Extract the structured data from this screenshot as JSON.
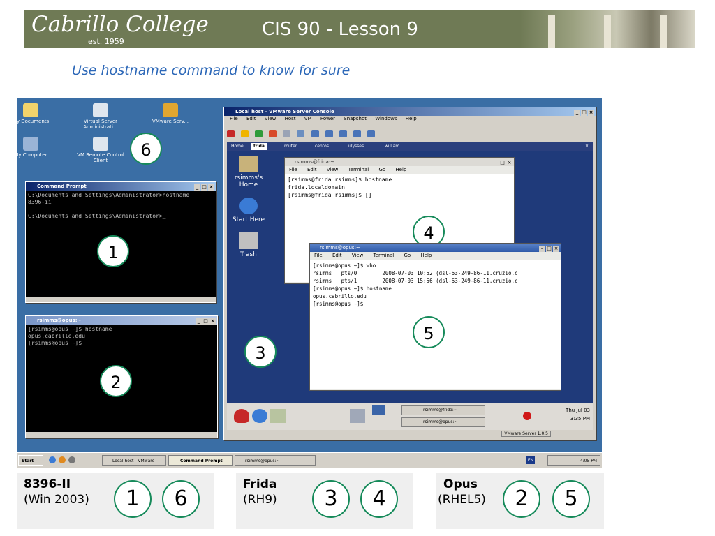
{
  "header": {
    "logo_text": "Cabrillo College",
    "logo_est": "est. 1959",
    "title": "CIS 90 - Lesson 9"
  },
  "subtitle": "Use hostname command to know for sure",
  "desktop": {
    "icons": [
      {
        "label": "My Documents",
        "icon": "folder-documents-icon"
      },
      {
        "label": "Virtual Server Administrati...",
        "icon": "server-admin-icon"
      },
      {
        "label": "VMware Serv...",
        "icon": "vmware-icon"
      },
      {
        "label": "My Computer",
        "icon": "computer-icon"
      },
      {
        "label": "VM Remote Control Client",
        "icon": "remote-control-icon"
      }
    ],
    "badges": [
      "1",
      "2",
      "3",
      "4",
      "5",
      "6"
    ],
    "cmd_window": {
      "title": "Command Prompt",
      "lines": "C:\\Documents and Settings\\Administrator>hostname\n8396-ii\n\nC:\\Documents and Settings\\Administrator>_"
    },
    "putty_window": {
      "title": "rsimms@opus:~",
      "lines": "[rsimms@opus ~]$ hostname\nopus.cabrillo.edu\n[rsimms@opus ~]$ "
    },
    "vmware": {
      "title": "Local host - VMware Server Console",
      "menu": [
        "File",
        "Edit",
        "View",
        "Host",
        "VM",
        "Power",
        "Snapshot",
        "Windows",
        "Help"
      ],
      "tabs": [
        "Home",
        "frida",
        "router",
        "centos",
        "ulysses",
        "william"
      ],
      "guest_icons": [
        "rsimms's Home",
        "Start Here",
        "Trash"
      ],
      "frida_term": {
        "title": "rsimms@frida:~",
        "menu": [
          "File",
          "Edit",
          "View",
          "Terminal",
          "Go",
          "Help"
        ],
        "lines": "[rsimms@frida rsimms]$ hostname\nfrida.localdomain\n[rsimms@frida rsimms]$ []"
      },
      "opus_term": {
        "title": "rsimms@opus:~",
        "menu": [
          "File",
          "Edit",
          "View",
          "Terminal",
          "Go",
          "Help"
        ],
        "lines": "[rsimms@opus ~]$ who\nrsimms   pts/0        2008-07-03 10:52 (dsl-63-249-86-11.cruzio.c\nrsimms   pts/1        2008-07-03 15:56 (dsl-63-249-86-11.cruzio.c\n[rsimms@opus ~]$ hostname\nopus.cabrillo.edu\n[rsimms@opus ~]$ "
      },
      "panel_tasks": [
        "rsimms@frida:~",
        "rsimms@opus:~"
      ],
      "clock_day": "Thu Jul 03",
      "clock_time": "3:35 PM",
      "status": "VMware Server 1.0.5"
    },
    "taskbar": {
      "start": "Start",
      "items": [
        "Local host - VMware Ser...",
        "Command Prompt",
        "rsimms@opus:~"
      ],
      "lang": "EN",
      "time": "4:05 PM"
    }
  },
  "legend": [
    {
      "name": "8396-II",
      "sub": "(Win 2003)",
      "badges": [
        "1",
        "6"
      ]
    },
    {
      "name": "Frida",
      "sub": "(RH9)",
      "badges": [
        "3",
        "4"
      ]
    },
    {
      "name": "Opus",
      "sub": "(RHEL5)",
      "badges": [
        "2",
        "5"
      ]
    }
  ],
  "colors": {
    "banner": "#6f7a55",
    "subtitle": "#2d68b8",
    "badge_border": "#168a5a",
    "xp_desktop": "#3a6ea5"
  }
}
